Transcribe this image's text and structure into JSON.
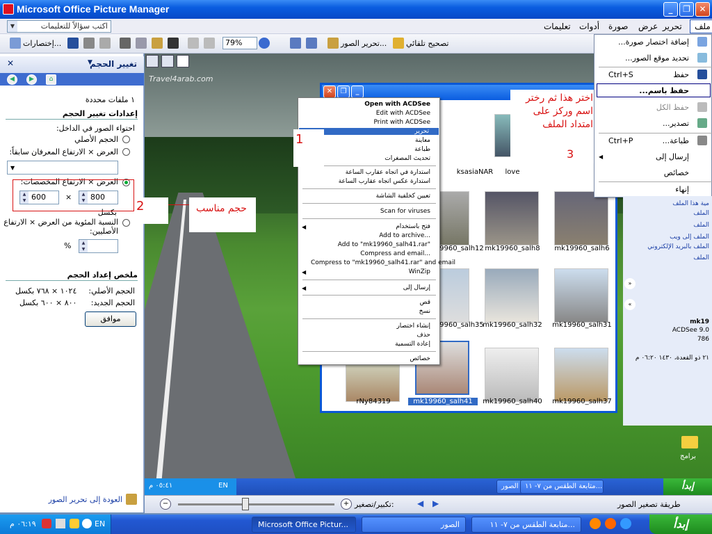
{
  "window": {
    "title": "Microsoft Office Picture Manager",
    "min": "_",
    "max": "❐",
    "close": "✕"
  },
  "help": {
    "placeholder": "اكتب سؤالاً للتعليمات"
  },
  "menu": [
    {
      "label": "ملف"
    },
    {
      "label": "تحرير"
    },
    {
      "label": "عرض"
    },
    {
      "label": "صورة"
    },
    {
      "label": "أدوات"
    },
    {
      "label": "تعليمات"
    }
  ],
  "toolbar": {
    "auto_correct": "تصحيح تلقائي",
    "edit_pictures": "تحرير الصور...",
    "shortcuts": "إختصارات...",
    "zoom": "79%"
  },
  "leftpane": {
    "title": "تغيير الحجم",
    "selected_count": "١ ملفات محددة",
    "settings_header": "إعدادات تغيير الحجم",
    "fit_label": "احتواء الصور في الداخل:",
    "opt_original": "الحجم الأصلي",
    "opt_predefined": "العرض × الارتفاع المعرفان سابقاً:",
    "opt_custom": "العرض × الارتفاع المخصصات:",
    "width": "800",
    "height": "600",
    "times": "×",
    "px": "بكسل",
    "opt_percent": "النسبة المئوية من العرض × الارتفاع الأصليين:",
    "percent_sign": "%",
    "summary_header": "ملخص إعداد الحجم",
    "orig_label": "الحجم الأصلي:",
    "orig_value": "١٠٢٤ × ٧٦٨ بكسل",
    "new_label": "الحجم الجديد:",
    "new_value": "٨٠٠ × ٦٠٠ بكسل",
    "ok": "موافق",
    "back": "العودة إلى تحرير الصور"
  },
  "desktop": {
    "watermark": "Travel4arab.com",
    "programs_icon": "برامج"
  },
  "acdsee": {
    "thumbs": [
      {
        "label": "ksasiaNAR"
      },
      {
        "label": "love"
      },
      {
        "label": "mk19960_salh12"
      },
      {
        "label": "mk19960_salh8"
      },
      {
        "label": "mk19960_salh6"
      },
      {
        "label": "mk19960_salh35"
      },
      {
        "label": "mk19960_salh32"
      },
      {
        "label": "mk19960_salh31"
      },
      {
        "label": "rNy84319"
      },
      {
        "label": "mk19960_salh41"
      },
      {
        "label": "mk19960_salh40"
      },
      {
        "label": "mk19960_salh37"
      }
    ]
  },
  "context": {
    "items": [
      "Open with ACDSee",
      "Edit with ACDSee",
      "Print with ACDSee",
      "تحرير",
      "معاينة",
      "طباعة",
      "تحديث المصغرات",
      "استدارة في اتجاه عقارب الساعة",
      "استدارة عكس اتجاه عقارب الساعة",
      "تعيين كخلفية الشاشة",
      "Scan for viruses",
      "فتح باستخدام",
      "Add to archive...",
      "Add to \"mk19960_salh41.rar\"",
      "Compress and email...",
      "Compress to \"mk19960_salh41.rar\" and email",
      "WinZip",
      "إرسال إلى",
      "قص",
      "نسخ",
      "إنشاء اختصار",
      "حذف",
      "إعادة التسمية",
      "خصائص"
    ]
  },
  "filemenu": {
    "items": [
      {
        "label": "إضافة اختصار صورة..."
      },
      {
        "label": "تحديد موقع الصور..."
      },
      {
        "label": "حفظ",
        "key": "Ctrl+S"
      },
      {
        "label": "حفظ باسم..."
      },
      {
        "label": "حفظ الكل"
      },
      {
        "label": "تصدير..."
      },
      {
        "label": "طباعة...",
        "key": "Ctrl+P"
      },
      {
        "label": "إرسال إلى"
      },
      {
        "label": "خصائص"
      },
      {
        "label": "إنهاء"
      }
    ]
  },
  "taskpane": {
    "items": [
      "مية هذا الملف",
      "الملف",
      "الملف",
      "الملف إلى ويب",
      "الملف بالبريد الإلكتروني",
      "الملف"
    ],
    "name": "mk19",
    "app": "ACDSee 9.0",
    "size": "786",
    "date": "٢١ ذو القعدة، ١٤٣٠ ٠٦:٢٠ م"
  },
  "annotations": {
    "n1": "1",
    "n2": "2",
    "n3": "3",
    "note_size": "حجم مناسب",
    "note_saveas": "اختر هذا ثم رختر اسم وركز على امتداد الملف"
  },
  "zoombar": {
    "label": "تكبير/تصغير:",
    "thumb_label": "طريقة تصغير الصور"
  },
  "intask": {
    "lang": "EN",
    "time": "٠٥:٤١ م",
    "btn1": "متابعة الطقس من ٧- ١١...",
    "btn2": "الصور",
    "start": "إبدأ"
  },
  "taskbar": {
    "lang": "EN",
    "time": "٠٦:١٩ م",
    "btn_pm": "Microsoft Office Pictur...",
    "btn_photos": "الصور",
    "btn_weather": "متابعة الطقس من ٧- ١١...",
    "start": "إبدأ"
  },
  "colors": {
    "accent": "#0a5de0",
    "annotation": "#d81212"
  }
}
